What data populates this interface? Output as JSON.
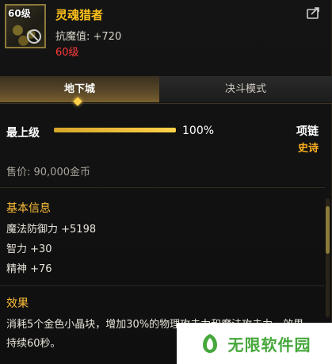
{
  "item": {
    "icon_level": "60级",
    "name": "灵魂猎者",
    "stat_line": "抗魔值: +720",
    "required_level": "60级"
  },
  "tabs": [
    {
      "label": "地下城",
      "active": true
    },
    {
      "label": "决斗模式",
      "active": false
    }
  ],
  "upgrade": {
    "label": "最上级",
    "progress": 1.0,
    "percent_text": "100%"
  },
  "slot": {
    "type": "项链",
    "rarity": "史诗"
  },
  "price": "售价: 90,000金币",
  "basic_info": {
    "title": "基本信息",
    "lines": [
      "魔法防御力 +5198",
      "智力 +30",
      "精神 +76"
    ]
  },
  "effect": {
    "title": "效果",
    "text": "消耗5个金色小晶块，增加30%的物理攻击力和魔法攻击力，效果持续60秒。"
  },
  "watermark": {
    "text": "无限软件园"
  },
  "colors": {
    "item_name": "#ffc21a",
    "required_level": "#ff3b3b",
    "rarity": "#ffb020",
    "section_title": "#ffbf3a",
    "progress": "#ffd24a",
    "watermark_text": "#46a83c"
  },
  "icons": {
    "share": "share-icon",
    "no_trade": "no-trade-icon",
    "tab_marker": "diamond-icon",
    "watermark_logo": "watermark-logo-icon"
  }
}
